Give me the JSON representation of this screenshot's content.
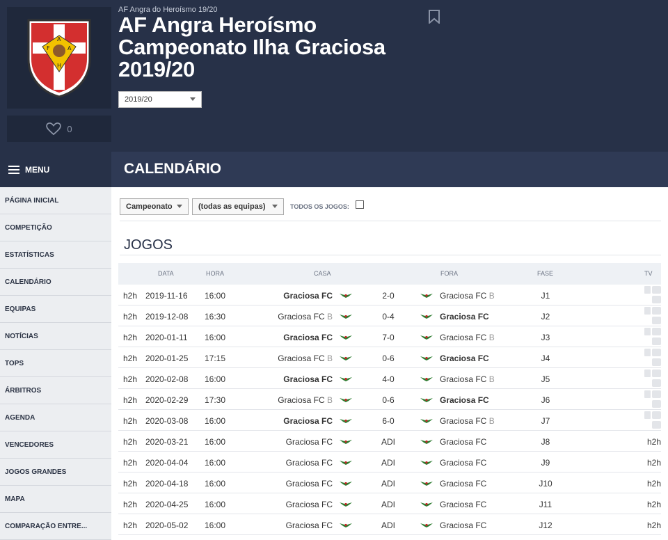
{
  "header": {
    "breadcrumb": "AF Angra do Heroísmo 19/20",
    "title": "AF Angra Heroísmo Campeonato Ilha Graciosa 2019/20",
    "season_select": "2019/20",
    "favorites_count": "0"
  },
  "menu": {
    "label": "MENU",
    "items": [
      "PÁGINA INICIAL",
      "COMPETIÇÃO",
      "ESTATÍSTICAS",
      "CALENDÁRIO",
      "EQUIPAS",
      "NOTÍCIAS",
      "TOPS",
      "ÁRBITROS",
      "AGENDA",
      "VENCEDORES",
      "JOGOS GRANDES",
      "MAPA",
      "COMPARAÇÃO ENTRE..."
    ]
  },
  "section_title": "CALENDÁRIO",
  "filters": {
    "competition": "Campeonato",
    "teams": "(todas as equipas)",
    "all_games_label": "TODOS OS JOGOS:"
  },
  "games_title": "JOGOS",
  "table": {
    "headers": {
      "date": "DATA",
      "time": "HORA",
      "home": "CASA",
      "away": "FORA",
      "phase": "FASE",
      "tv": "TV"
    },
    "rows": [
      {
        "h2h": "h2h",
        "date": "2019-11-16",
        "time": "16:00",
        "home": "Graciosa FC",
        "home_suffix": "",
        "home_bold": true,
        "score": "2-0",
        "away": "Graciosa FC",
        "away_suffix": "B",
        "away_bold": false,
        "phase": "J1",
        "tv": ""
      },
      {
        "h2h": "h2h",
        "date": "2019-12-08",
        "time": "16:30",
        "home": "Graciosa FC",
        "home_suffix": "B",
        "home_bold": false,
        "score": "0-4",
        "away": "Graciosa FC",
        "away_suffix": "",
        "away_bold": true,
        "phase": "J2",
        "tv": ""
      },
      {
        "h2h": "h2h",
        "date": "2020-01-11",
        "time": "16:00",
        "home": "Graciosa FC",
        "home_suffix": "",
        "home_bold": true,
        "score": "7-0",
        "away": "Graciosa FC",
        "away_suffix": "B",
        "away_bold": false,
        "phase": "J3",
        "tv": ""
      },
      {
        "h2h": "h2h",
        "date": "2020-01-25",
        "time": "17:15",
        "home": "Graciosa FC",
        "home_suffix": "B",
        "home_bold": false,
        "score": "0-6",
        "away": "Graciosa FC",
        "away_suffix": "",
        "away_bold": true,
        "phase": "J4",
        "tv": ""
      },
      {
        "h2h": "h2h",
        "date": "2020-02-08",
        "time": "16:00",
        "home": "Graciosa FC",
        "home_suffix": "",
        "home_bold": true,
        "score": "4-0",
        "away": "Graciosa FC",
        "away_suffix": "B",
        "away_bold": false,
        "phase": "J5",
        "tv": ""
      },
      {
        "h2h": "h2h",
        "date": "2020-02-29",
        "time": "17:30",
        "home": "Graciosa FC",
        "home_suffix": "B",
        "home_bold": false,
        "score": "0-6",
        "away": "Graciosa FC",
        "away_suffix": "",
        "away_bold": true,
        "phase": "J6",
        "tv": ""
      },
      {
        "h2h": "h2h",
        "date": "2020-03-08",
        "time": "16:00",
        "home": "Graciosa FC",
        "home_suffix": "",
        "home_bold": true,
        "score": "6-0",
        "away": "Graciosa FC",
        "away_suffix": "B",
        "away_bold": false,
        "phase": "J7",
        "tv": ""
      },
      {
        "h2h": "h2h",
        "date": "2020-03-21",
        "time": "16:00",
        "home": "Graciosa FC",
        "home_suffix": "",
        "home_bold": false,
        "score": "ADI",
        "away": "Graciosa FC",
        "away_suffix": "",
        "away_bold": false,
        "phase": "J8",
        "tv": "h2h"
      },
      {
        "h2h": "h2h",
        "date": "2020-04-04",
        "time": "16:00",
        "home": "Graciosa FC",
        "home_suffix": "",
        "home_bold": false,
        "score": "ADI",
        "away": "Graciosa FC",
        "away_suffix": "",
        "away_bold": false,
        "phase": "J9",
        "tv": "h2h"
      },
      {
        "h2h": "h2h",
        "date": "2020-04-18",
        "time": "16:00",
        "home": "Graciosa FC",
        "home_suffix": "",
        "home_bold": false,
        "score": "ADI",
        "away": "Graciosa FC",
        "away_suffix": "",
        "away_bold": false,
        "phase": "J10",
        "tv": "h2h"
      },
      {
        "h2h": "h2h",
        "date": "2020-04-25",
        "time": "16:00",
        "home": "Graciosa FC",
        "home_suffix": "",
        "home_bold": false,
        "score": "ADI",
        "away": "Graciosa FC",
        "away_suffix": "",
        "away_bold": false,
        "phase": "J11",
        "tv": "h2h"
      },
      {
        "h2h": "h2h",
        "date": "2020-05-02",
        "time": "16:00",
        "home": "Graciosa FC",
        "home_suffix": "",
        "home_bold": false,
        "score": "ADI",
        "away": "Graciosa FC",
        "away_suffix": "",
        "away_bold": false,
        "phase": "J12",
        "tv": "h2h"
      }
    ]
  },
  "colors": {
    "header_bg": "#273148",
    "section_bg": "#2f3a55",
    "badge_green": "#2e7d32",
    "badge_red": "#c62828"
  }
}
